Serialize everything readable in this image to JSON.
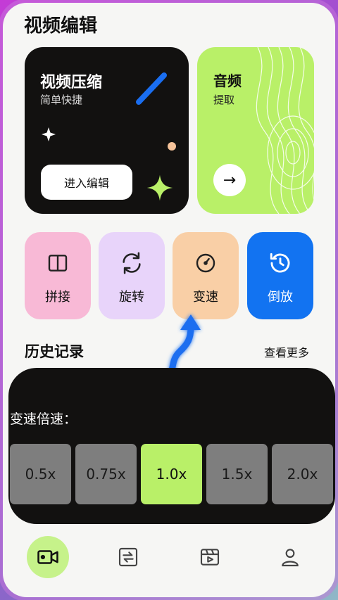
{
  "app": {
    "title": "视频编辑"
  },
  "compress_card": {
    "title": "视频压缩",
    "subtitle": "简单快捷",
    "button_label": "进入编辑"
  },
  "audio_card": {
    "title": "音频",
    "subtitle": "提取",
    "arrow": "→"
  },
  "tools": [
    {
      "label": "拼接",
      "icon": "split-panel-icon"
    },
    {
      "label": "旋转",
      "icon": "rotate-icon"
    },
    {
      "label": "变速",
      "icon": "speedometer-icon"
    },
    {
      "label": "倒放",
      "icon": "history-clock-icon"
    }
  ],
  "history": {
    "title": "历史记录",
    "more_label": "查看更多"
  },
  "speed_panel": {
    "label": "变速倍速：",
    "options": [
      "0.5x",
      "0.75x",
      "1.0x",
      "1.5x",
      "2.0x"
    ],
    "selected": "1.0x"
  },
  "nav": {
    "items": [
      "video-camera-icon",
      "swap-icon",
      "clapperboard-icon",
      "user-icon"
    ],
    "active": "video-camera-icon"
  },
  "colors": {
    "accent_green": "#b9f068",
    "accent_blue": "#1273f1",
    "dark": "#121110"
  }
}
